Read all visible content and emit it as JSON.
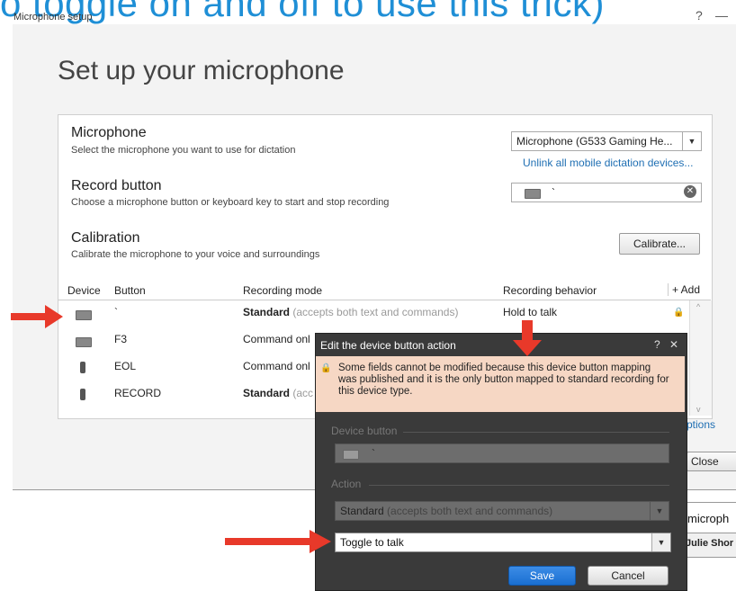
{
  "overlay": {
    "caption": "o toggle on and off to use this trick)"
  },
  "window": {
    "title": "Microphone setup",
    "help": "?",
    "minimize": "—"
  },
  "page": {
    "heading": "Set up your microphone"
  },
  "microphone": {
    "title": "Microphone",
    "subtitle": "Select the microphone you want to use for dictation",
    "selected": "Microphone (G533 Gaming He...",
    "unlink_link": "Unlink all mobile dictation devices..."
  },
  "record_button": {
    "title": "Record button",
    "subtitle": "Choose a microphone button or keyboard key to start and stop recording",
    "value": "`"
  },
  "calibration": {
    "title": "Calibration",
    "subtitle": "Calibrate the microphone to your voice and surroundings",
    "button": "Calibrate..."
  },
  "table": {
    "columns": [
      "Device",
      "Button",
      "Recording mode",
      "Recording behavior"
    ],
    "add_label": "+ Add",
    "rows": [
      {
        "icon": "keyboard-icon",
        "button": "`",
        "mode": "Standard",
        "mode_note": "(accepts both text and commands)",
        "behavior": "Hold to talk"
      },
      {
        "icon": "keyboard-icon",
        "button": "F3",
        "mode": "Command onl",
        "mode_note": "",
        "behavior": ""
      },
      {
        "icon": "microphone-device-icon",
        "button": "EOL",
        "mode": "Command onl",
        "mode_note": "",
        "behavior": ""
      },
      {
        "icon": "microphone-device-icon",
        "button": "RECORD",
        "mode": "Standard",
        "mode_note": "(acc",
        "behavior": ""
      }
    ]
  },
  "partial": {
    "options_link": "ptions",
    "close_button": "Close",
    "right_text1": "microph",
    "right_text2": "Julie Shor"
  },
  "dialog": {
    "title": "Edit the device button action",
    "help": "?",
    "close": "✕",
    "warning": "Some fields cannot be modified because this device button mapping was published and it is the only button mapped to standard recording for this device type.",
    "device_button_label": "Device button",
    "device_button_value": "`",
    "action_label": "Action",
    "mode_value": "Standard",
    "mode_note": "(accepts both text and commands)",
    "behavior_value": "Toggle to talk",
    "save": "Save",
    "cancel": "Cancel"
  },
  "colors": {
    "accent": "#1f8fd6",
    "dialog_bg": "#3a3a3a",
    "warning_bg": "#f6d7c4",
    "save_blue": "#1a6fd1",
    "arrow": "#e8392a"
  }
}
